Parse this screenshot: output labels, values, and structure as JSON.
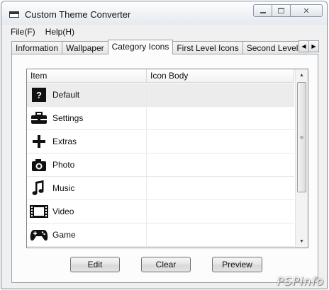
{
  "window": {
    "title": "Custom Theme Converter"
  },
  "menu": [
    "File(F)",
    "Help(H)"
  ],
  "tabs": [
    {
      "label": "Information"
    },
    {
      "label": "Wallpaper"
    },
    {
      "label": "Category Icons",
      "active": true
    },
    {
      "label": "First Level Icons"
    },
    {
      "label": "Second Level Icons"
    }
  ],
  "list": {
    "columns": [
      "Item",
      "Icon Body"
    ],
    "rows": [
      {
        "label": "Default",
        "icon": "question-icon",
        "body": "",
        "selected": true
      },
      {
        "label": "Settings",
        "icon": "toolbox-icon",
        "body": ""
      },
      {
        "label": "Extras",
        "icon": "plus-icon",
        "body": ""
      },
      {
        "label": "Photo",
        "icon": "camera-icon",
        "body": ""
      },
      {
        "label": "Music",
        "icon": "music-note-icon",
        "body": ""
      },
      {
        "label": "Video",
        "icon": "film-strip-icon",
        "body": ""
      },
      {
        "label": "Game",
        "icon": "gamepad-icon",
        "body": ""
      }
    ]
  },
  "buttons": {
    "edit": "Edit",
    "clear": "Clear",
    "preview": "Preview"
  },
  "watermark": "PSPinfo"
}
